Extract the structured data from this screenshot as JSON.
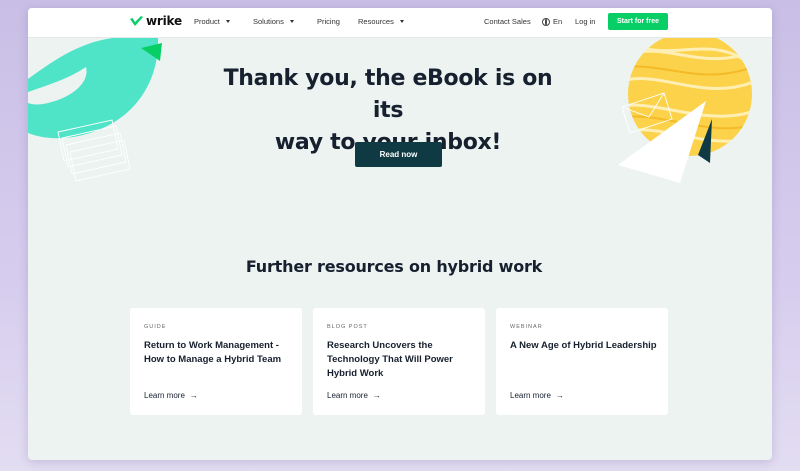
{
  "nav": {
    "logo": "wrike",
    "items": [
      {
        "label": "Product",
        "has_caret": true
      },
      {
        "label": "Solutions",
        "has_caret": true
      },
      {
        "label": "Pricing",
        "has_caret": false
      },
      {
        "label": "Resources",
        "has_caret": true
      }
    ],
    "contact": "Contact Sales",
    "language": "En",
    "login": "Log in",
    "cta": "Start for free"
  },
  "hero": {
    "title_line1": "Thank you, the eBook is on its",
    "title_line2": "way to your inbox!",
    "button": "Read now"
  },
  "resources": {
    "title": "Further resources on hybrid work",
    "cards": [
      {
        "category": "GUIDE",
        "title": "Return to Work Management - How to Manage a Hybrid Team",
        "link": "Learn more"
      },
      {
        "category": "BLOG POST",
        "title": "Research Uncovers the Technology That Will Power Hybrid Work",
        "link": "Learn more"
      },
      {
        "category": "WEBINAR",
        "title": "A New Age of Hybrid Leadership",
        "link": "Learn more"
      }
    ]
  },
  "colors": {
    "brand_green": "#08cf65",
    "dark_teal": "#0f3a44",
    "page_bg": "#ecf3f1",
    "backdrop": "#cfc6ea"
  }
}
